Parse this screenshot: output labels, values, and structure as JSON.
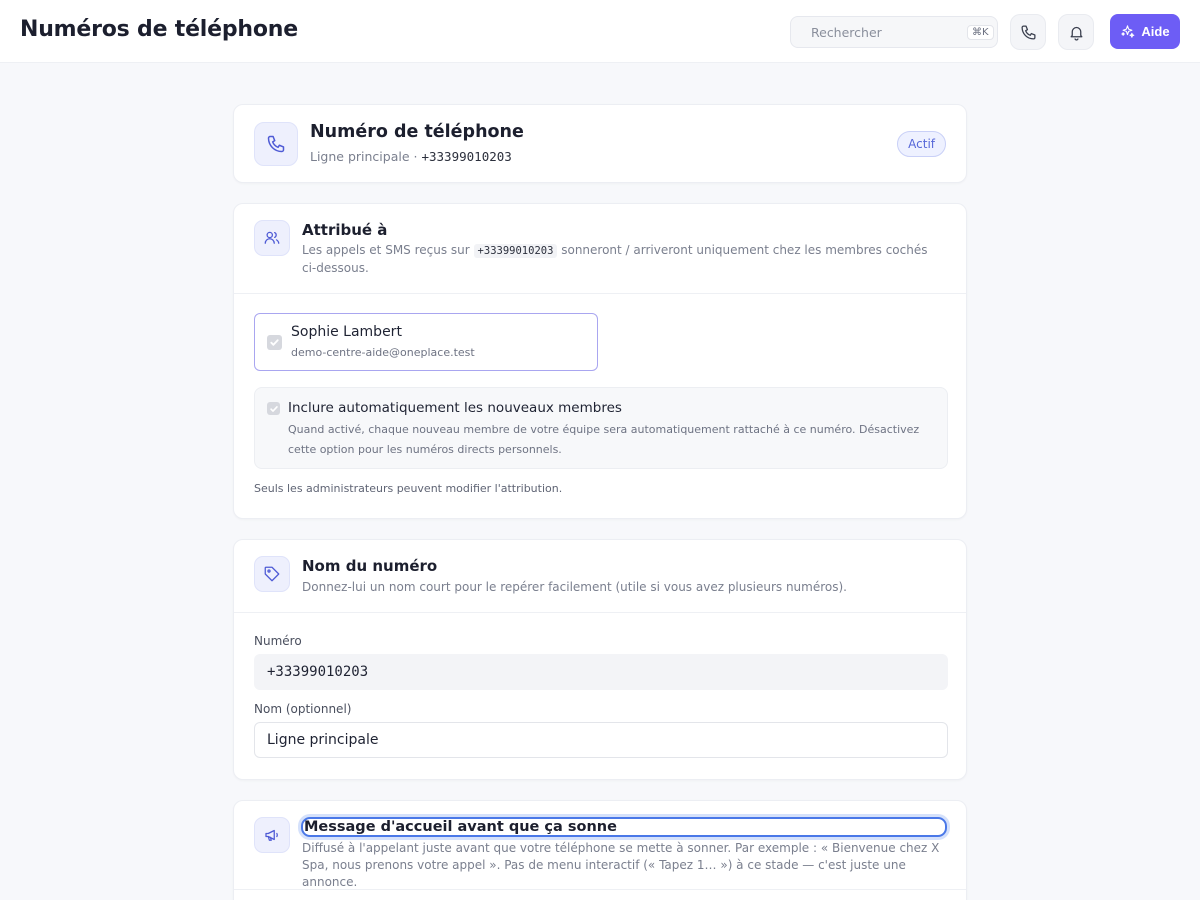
{
  "header": {
    "title": "Numéros de téléphone",
    "search_placeholder": "Rechercher",
    "search_shortcut": "⌘K",
    "help_label": "Aide"
  },
  "summary": {
    "title": "Numéro de téléphone",
    "line_name": "Ligne principale",
    "separator": "·",
    "number": "+33399010203",
    "status": "Actif"
  },
  "assigned": {
    "title": "Attribué à",
    "desc_before": "Les appels et SMS reçus sur",
    "desc_number": "+33399010203",
    "desc_after": "sonneront / arriveront uniquement chez les membres cochés ci-dessous.",
    "member": {
      "name": "Sophie Lambert",
      "email": "demo-centre-aide@oneplace.test"
    },
    "auto_include": {
      "title": "Inclure automatiquement les nouveaux membres",
      "desc": "Quand activé, chaque nouveau membre de votre équipe sera automatiquement rattaché à ce numéro. Désactivez cette option pour les numéros directs personnels."
    },
    "admin_note": "Seuls les administrateurs peuvent modifier l'attribution."
  },
  "naming": {
    "title": "Nom du numéro",
    "desc": "Donnez-lui un nom court pour le repérer facilement (utile si vous avez plusieurs numéros).",
    "number_label": "Numéro",
    "number_value": "+33399010203",
    "name_label": "Nom (optionnel)",
    "name_value": "Ligne principale"
  },
  "greeting": {
    "title": "Message d'accueil avant que ça sonne",
    "desc": "Diffusé à l'appelant juste avant que votre téléphone se mette à sonner. Par exemple : « Bienvenue chez X Spa, nous prenons votre appel ». Pas de menu interactif (« Tapez 1… ») à ce stade — c'est juste une annonce."
  },
  "colors": {
    "accent": "#6d5df5",
    "badge_text": "#5667d8",
    "focus_ring": "#4a78e8"
  }
}
